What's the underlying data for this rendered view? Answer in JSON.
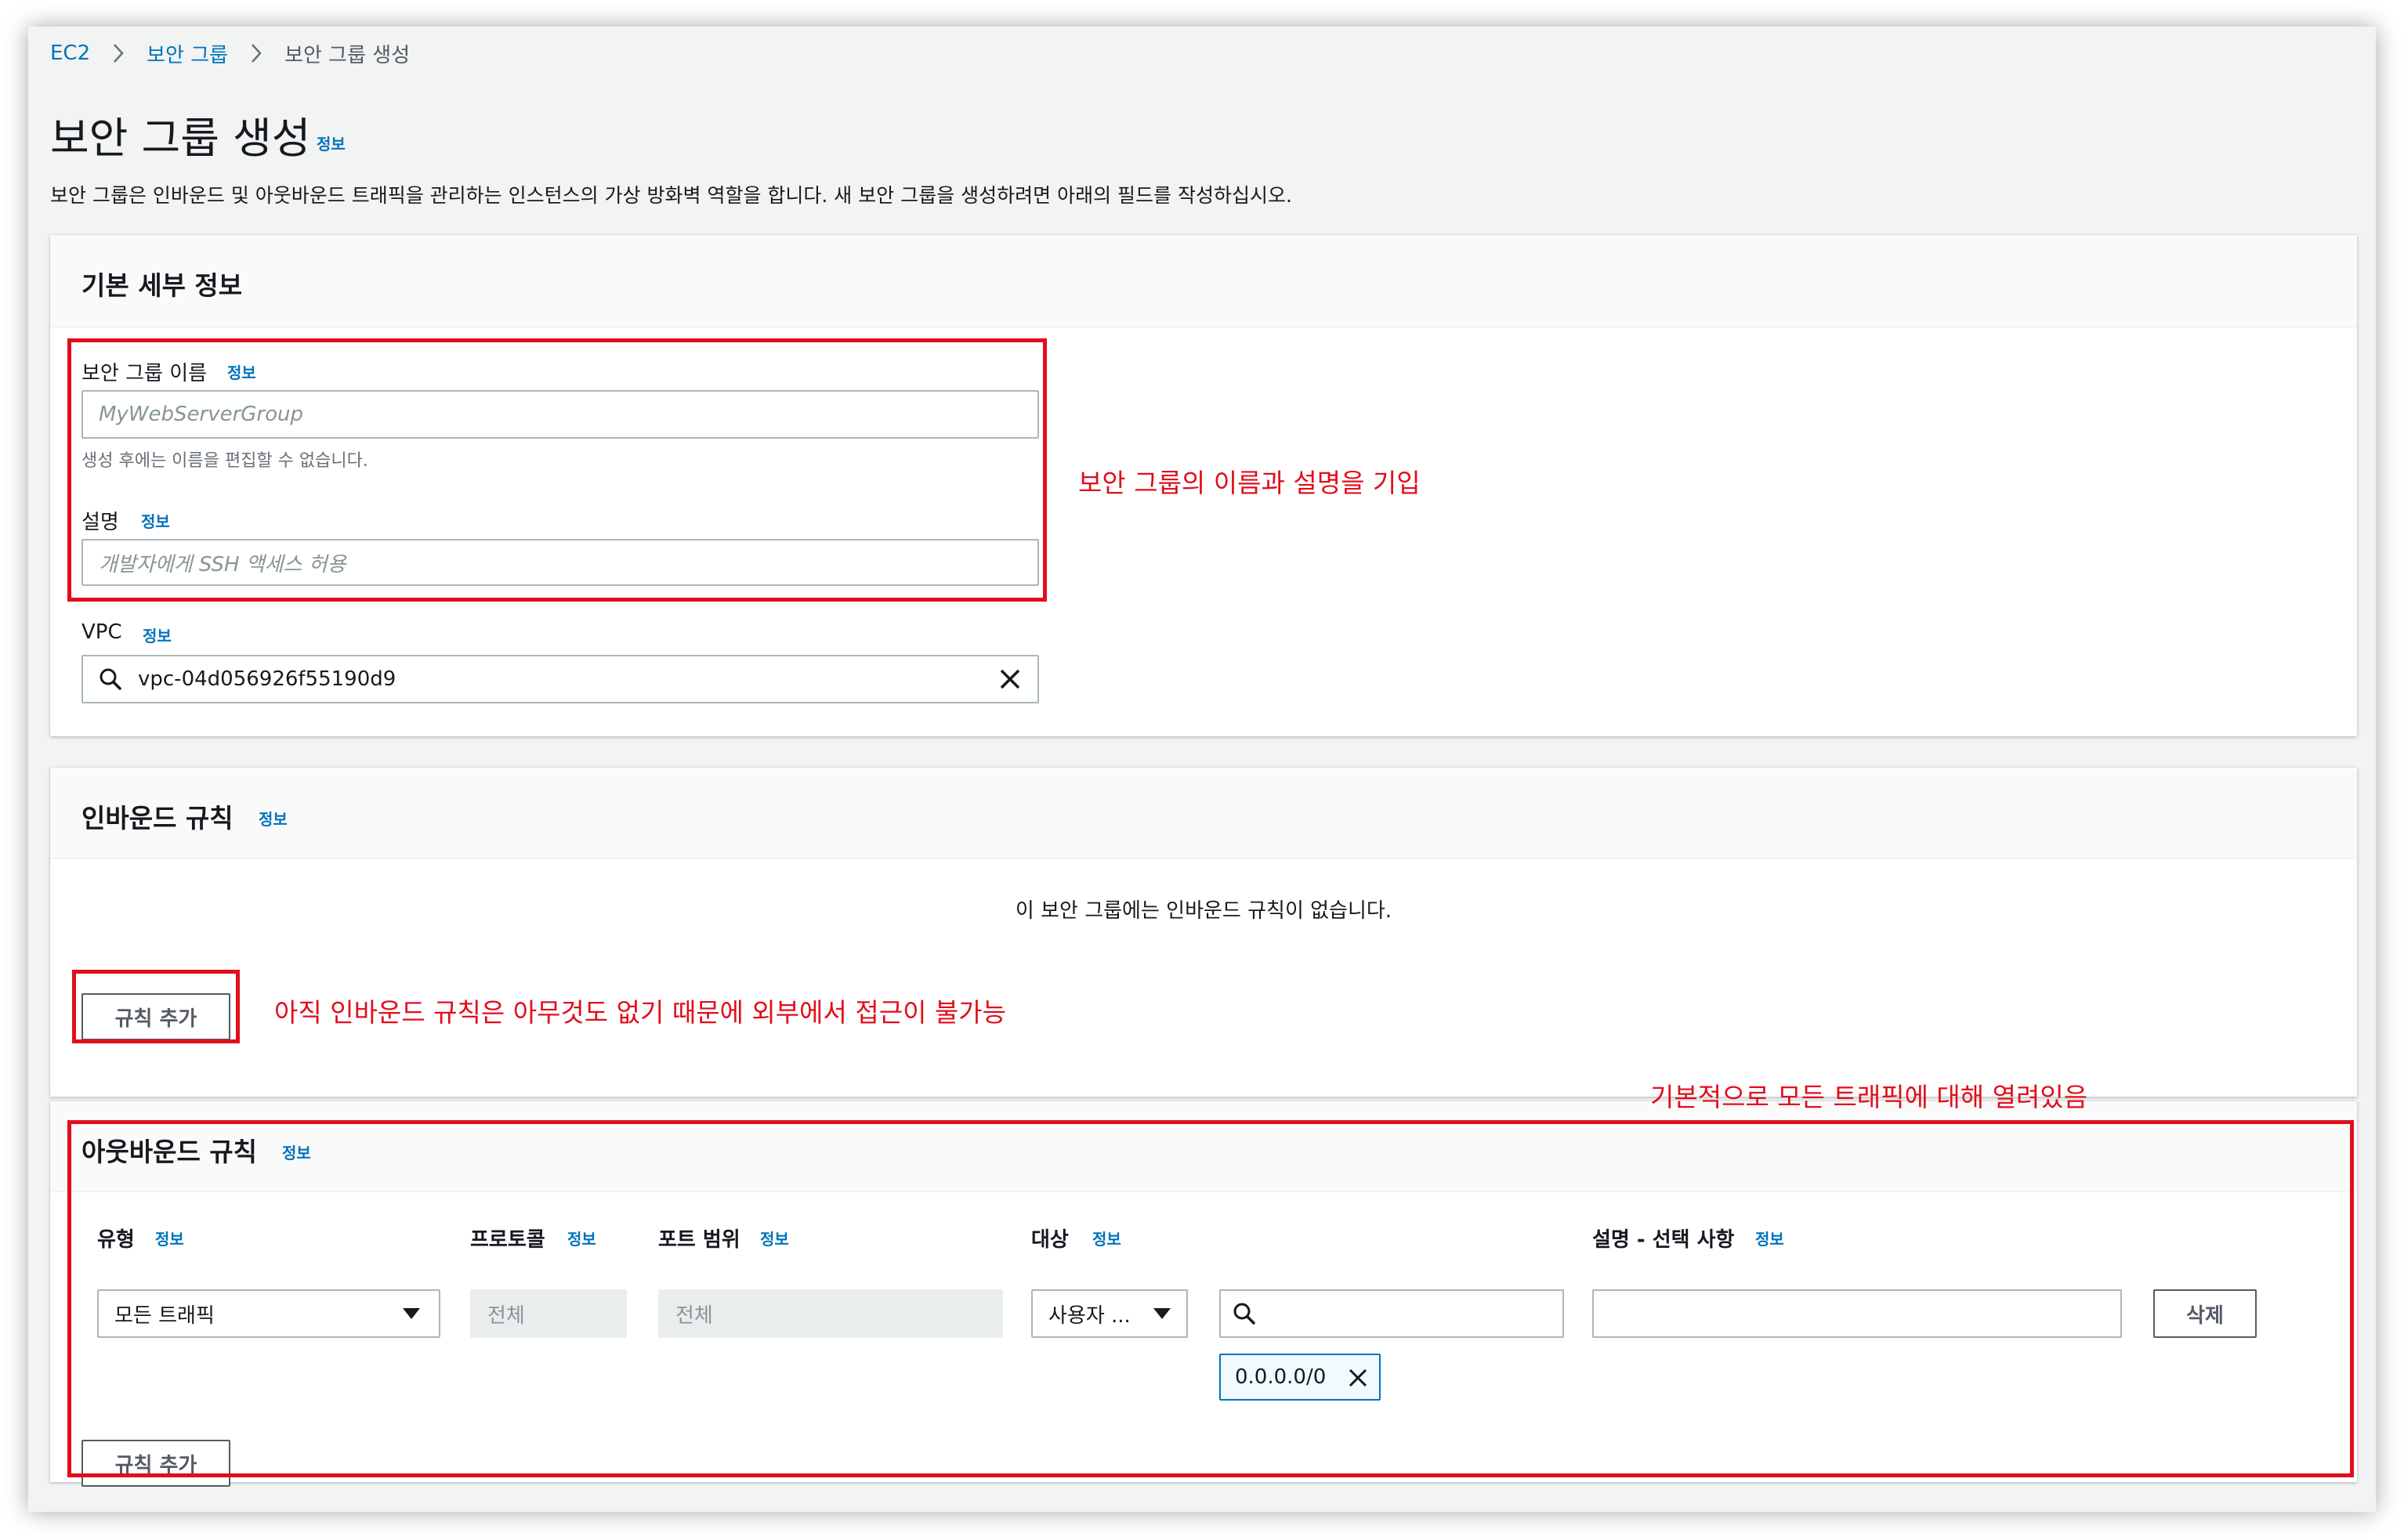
{
  "breadcrumb": {
    "root": "EC2",
    "parent": "보안 그룹",
    "current": "보안 그룹 생성"
  },
  "page": {
    "title": "보안 그룹 생성",
    "info": "정보",
    "description": "보안 그룹은 인바운드 및 아웃바운드 트래픽을 관리하는 인스턴스의 가상 방화벽 역할을 합니다. 새 보안 그룹을 생성하려면 아래의 필드를 작성하십시오."
  },
  "basic": {
    "title": "기본 세부 정보",
    "name_label": "보안 그룹 이름",
    "name_info": "정보",
    "name_placeholder": "MyWebServerGroup",
    "name_hint": "생성 후에는 이름을 편집할 수 없습니다.",
    "desc_label": "설명",
    "desc_info": "정보",
    "desc_placeholder": "개발자에게 SSH 액세스 허용",
    "vpc_label": "VPC",
    "vpc_info": "정보",
    "vpc_value": "vpc-04d056926f55190d9"
  },
  "inbound": {
    "title": "인바운드 규칙",
    "info": "정보",
    "empty_text": "이 보안 그룹에는 인바운드 규칙이 없습니다.",
    "add_button": "규칙 추가"
  },
  "outbound": {
    "title": "아웃바운드 규칙",
    "info": "정보",
    "columns": {
      "type": "유형",
      "protocol": "프로토콜",
      "port": "포트 범위",
      "dest": "대상",
      "desc": "설명 - 선택 사항",
      "info": "정보"
    },
    "row": {
      "type": "모든 트래픽",
      "protocol": "전체",
      "port": "전체",
      "dest_type": "사용자 ...",
      "dest_search_value": "",
      "cidr": "0.0.0.0/0",
      "desc_value": "",
      "delete_button": "삭제"
    },
    "add_button": "규칙 추가"
  },
  "annotations": {
    "basic_note": "보안 그룹의 이름과 설명을 기입",
    "inbound_note": "아직  인바운드 규칙은 아무것도 없기 때문에 외부에서 접근이 불가능",
    "outbound_note": "기본적으로 모든 트래픽에 대해 열려있음"
  },
  "colors": {
    "link": "#0073bb",
    "annotation_red": "#e10e1c",
    "page_bg": "#f2f3f3"
  }
}
